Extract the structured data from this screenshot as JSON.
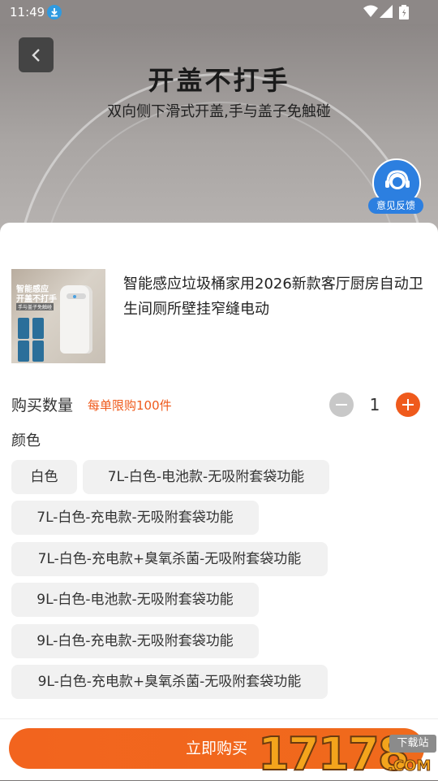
{
  "status_bar": {
    "time": "11:49",
    "icons": [
      "download-icon",
      "wifi-icon",
      "signal-icon",
      "battery-icon"
    ]
  },
  "banner": {
    "title": "开盖不打手",
    "subtitle": "双向侧下滑式开盖,手与盖子免触碰"
  },
  "feedback": {
    "label": "意见反馈"
  },
  "product": {
    "title": "智能感应垃圾桶家用2026新款客厅厨房自动卫生间厕所壁挂窄缝电动",
    "thumb_text_1": "智能感应",
    "thumb_text_2": "开盖不打手",
    "thumb_text_3": "手与盖子免触碰"
  },
  "quantity": {
    "label": "购买数量",
    "limit": "每单限购100件",
    "value": "1"
  },
  "color": {
    "label": "颜色",
    "options": [
      "白色",
      "7L-白色-电池款-无吸附套袋功能",
      "7L-白色-充电款-无吸附套袋功能",
      "7L-白色-充电款+臭氧杀菌-无吸附套袋功能",
      "9L-白色-电池款-无吸附套袋功能",
      "9L-白色-充电款-无吸附套袋功能",
      "9L-白色-充电款+臭氧杀菌-无吸附套袋功能"
    ]
  },
  "buy_button": {
    "label": "立即购买"
  },
  "watermark": {
    "digits": "17178",
    "tag": "下载站",
    "suffix": ".COM"
  },
  "colors": {
    "accent": "#ef5a1c",
    "feedback_blue": "#2c7fe0"
  }
}
